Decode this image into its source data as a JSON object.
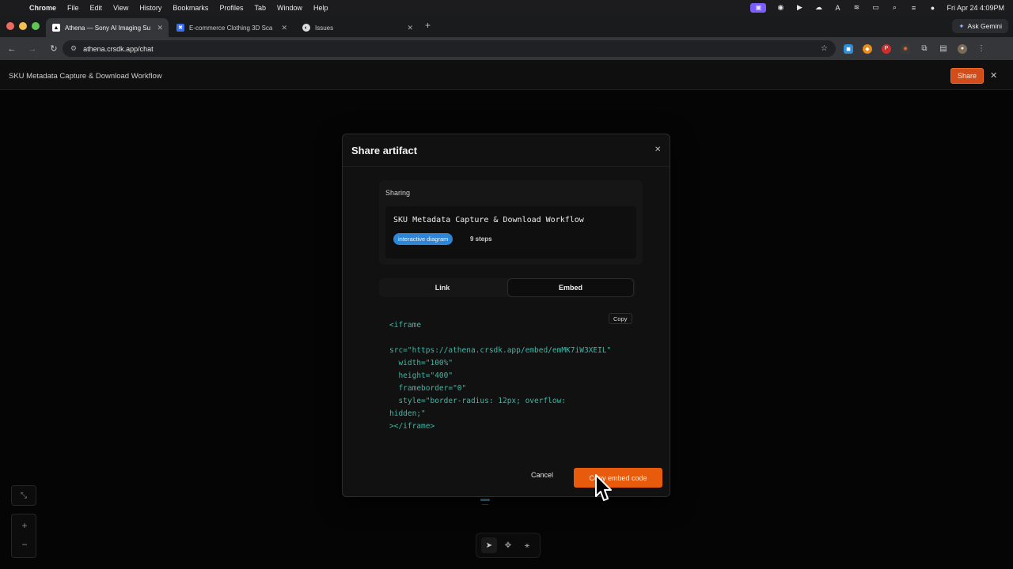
{
  "menubar": {
    "app_name": "Chrome",
    "items": [
      "File",
      "Edit",
      "View",
      "History",
      "Bookmarks",
      "Profiles",
      "Tab",
      "Window",
      "Help"
    ],
    "datetime": "Fri Apr 24  4:09PM"
  },
  "tabs": [
    {
      "label": "Athena — Sony AI Imaging Su",
      "icon": "athena-icon"
    },
    {
      "label": "E-commerce Clothing 3D Sca",
      "icon": "app-icon"
    },
    {
      "label": "Issues",
      "icon": "issues-icon"
    }
  ],
  "ask_gemini": "Ask Gemini",
  "address_bar": {
    "url": "athena.crsdk.app/chat"
  },
  "appbar": {
    "title": "SKU Metadata Capture & Download Workflow",
    "share_label": "Share"
  },
  "modal": {
    "title": "Share artifact",
    "sharing_label": "Sharing",
    "artifact_name": "SKU Metadata Capture & Download Workflow",
    "artifact_type": "interactive diagram",
    "steps": "9 steps",
    "tab_link": "Link",
    "tab_embed": "Embed",
    "copy_label": "Copy",
    "code_lines": [
      "<iframe",
      "",
      "src=\"https://athena.crsdk.app/embed/emMK7iW3XEIL\"",
      "  width=\"100%\"",
      "  height=\"400\"",
      "  frameborder=\"0\"",
      "  style=\"border-radius: 12px; overflow:",
      "hidden;\"",
      "></iframe>"
    ],
    "cancel_label": "Cancel",
    "copy_embed_label": "Copy embed code"
  },
  "colors": {
    "accent": "#e85a0c",
    "badge": "#2f86d6",
    "code": "#3fb7a6"
  }
}
